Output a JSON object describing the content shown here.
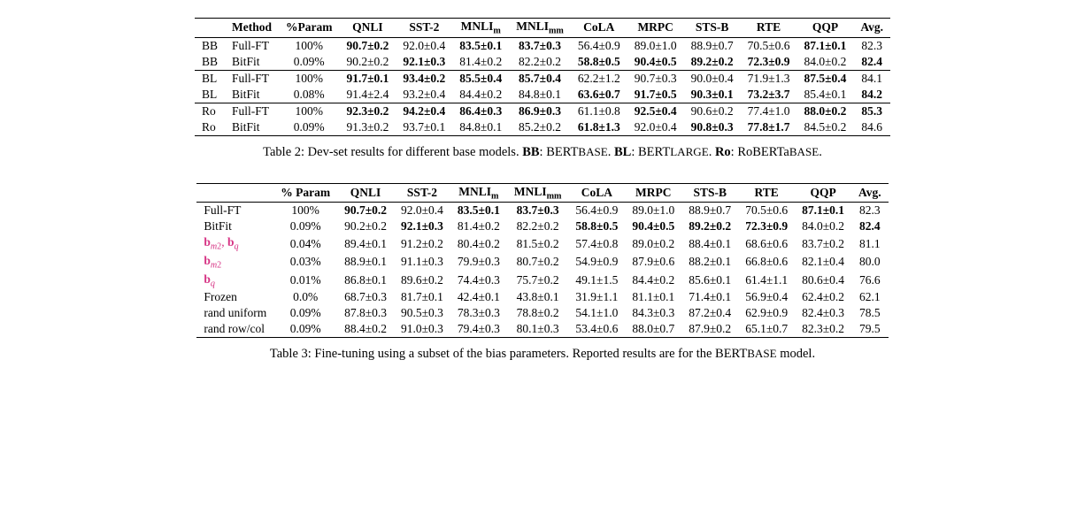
{
  "table2": {
    "headers": [
      "",
      "Method",
      "%Param",
      "QNLI",
      "SST-2",
      "MNLI_m",
      "MNLI_mm",
      "CoLA",
      "MRPC",
      "STS-B",
      "RTE",
      "QQP",
      "Avg."
    ],
    "rows": [
      {
        "model": "BB",
        "method": "Full-FT",
        "param": "100%",
        "qnli": "90.7±0.2",
        "qnli_b": true,
        "sst2": "92.0±0.4",
        "sst2_b": false,
        "mnlim": "83.5±0.1",
        "mnlim_b": true,
        "mnlimm": "83.7±0.3",
        "mnlimm_b": true,
        "cola": "56.4±0.9",
        "cola_b": false,
        "mrpc": "89.0±1.0",
        "mrpc_b": false,
        "stsb": "88.9±0.7",
        "stsb_b": false,
        "rte": "70.5±0.6",
        "rte_b": false,
        "qqp": "87.1±0.1",
        "qqp_b": true,
        "avg": "82.3",
        "avg_b": false
      },
      {
        "model": "BB",
        "method": "BitFit",
        "param": "0.09%",
        "qnli": "90.2±0.2",
        "qnli_b": false,
        "sst2": "92.1±0.3",
        "sst2_b": true,
        "mnlim": "81.4±0.2",
        "mnlim_b": false,
        "mnlimm": "82.2±0.2",
        "mnlimm_b": false,
        "cola": "58.8±0.5",
        "cola_b": true,
        "mrpc": "90.4±0.5",
        "mrpc_b": true,
        "stsb": "89.2±0.2",
        "stsb_b": true,
        "rte": "72.3±0.9",
        "rte_b": true,
        "qqp": "84.0±0.2",
        "qqp_b": false,
        "avg": "82.4",
        "avg_b": true
      },
      {
        "model": "BL",
        "method": "Full-FT",
        "param": "100%",
        "qnli": "91.7±0.1",
        "qnli_b": true,
        "sst2": "93.4±0.2",
        "sst2_b": true,
        "mnlim": "85.5±0.4",
        "mnlim_b": true,
        "mnlimm": "85.7±0.4",
        "mnlimm_b": true,
        "cola": "62.2±1.2",
        "cola_b": false,
        "mrpc": "90.7±0.3",
        "mrpc_b": false,
        "stsb": "90.0±0.4",
        "stsb_b": false,
        "rte": "71.9±1.3",
        "rte_b": false,
        "qqp": "87.5±0.4",
        "qqp_b": true,
        "avg": "84.1",
        "avg_b": false
      },
      {
        "model": "BL",
        "method": "BitFit",
        "param": "0.08%",
        "qnli": "91.4±2.4",
        "qnli_b": false,
        "sst2": "93.2±0.4",
        "sst2_b": false,
        "mnlim": "84.4±0.2",
        "mnlim_b": false,
        "mnlimm": "84.8±0.1",
        "mnlimm_b": false,
        "cola": "63.6±0.7",
        "cola_b": true,
        "mrpc": "91.7±0.5",
        "mrpc_b": true,
        "stsb": "90.3±0.1",
        "stsb_b": true,
        "rte": "73.2±3.7",
        "rte_b": true,
        "qqp": "85.4±0.1",
        "qqp_b": false,
        "avg": "84.2",
        "avg_b": true
      },
      {
        "model": "Ro",
        "method": "Full-FT",
        "param": "100%",
        "qnli": "92.3±0.2",
        "qnli_b": true,
        "sst2": "94.2±0.4",
        "sst2_b": true,
        "mnlim": "86.4±0.3",
        "mnlim_b": true,
        "mnlimm": "86.9±0.3",
        "mnlimm_b": true,
        "cola": "61.1±0.8",
        "cola_b": false,
        "mrpc": "92.5±0.4",
        "mrpc_b": true,
        "stsb": "90.6±0.2",
        "stsb_b": false,
        "rte": "77.4±1.0",
        "rte_b": false,
        "qqp": "88.0±0.2",
        "qqp_b": true,
        "avg": "85.3",
        "avg_b": true
      },
      {
        "model": "Ro",
        "method": "BitFit",
        "param": "0.09%",
        "qnli": "91.3±0.2",
        "qnli_b": false,
        "sst2": "93.7±0.1",
        "sst2_b": false,
        "mnlim": "84.8±0.1",
        "mnlim_b": false,
        "mnlimm": "85.2±0.2",
        "mnlimm_b": false,
        "cola": "61.8±1.3",
        "cola_b": true,
        "mrpc": "92.0±0.4",
        "mrpc_b": false,
        "stsb": "90.8±0.3",
        "stsb_b": true,
        "rte": "77.8±1.7",
        "rte_b": true,
        "qqp": "84.5±0.2",
        "qqp_b": false,
        "avg": "84.6",
        "avg_b": false
      }
    ],
    "caption_pre": "Table 2:  Dev-set results for different base models. ",
    "caption_bb": "BB",
    "caption_bb_ex": ": BERT",
    "caption_bb_sub": "BASE",
    "caption_bl": "BL",
    "caption_bl_ex": ": BERT",
    "caption_bl_sub": "LARGE",
    "caption_ro": "Ro",
    "caption_ro_ex": ": RoBERTa",
    "caption_ro_sub": "BASE"
  },
  "table3": {
    "headers": [
      "",
      "% Param",
      "QNLI",
      "SST-2",
      "MNLI_m",
      "MNLI_mm",
      "CoLA",
      "MRPC",
      "STS-B",
      "RTE",
      "QQP",
      "Avg."
    ],
    "rows": [
      {
        "method": "Full-FT",
        "pink": false,
        "param": "100%",
        "qnli": "90.7±0.2",
        "qnli_b": true,
        "sst2": "92.0±0.4",
        "sst2_b": false,
        "mnlim": "83.5±0.1",
        "mnlim_b": true,
        "mnlimm": "83.7±0.3",
        "mnlimm_b": true,
        "cola": "56.4±0.9",
        "cola_b": false,
        "mrpc": "89.0±1.0",
        "mrpc_b": false,
        "stsb": "88.9±0.7",
        "stsb_b": false,
        "rte": "70.5±0.6",
        "rte_b": false,
        "qqp": "87.1±0.1",
        "qqp_b": true,
        "avg": "82.3",
        "avg_b": false
      },
      {
        "method": "BitFit",
        "pink": false,
        "param": "0.09%",
        "qnli": "90.2±0.2",
        "qnli_b": false,
        "sst2": "92.1±0.3",
        "sst2_b": true,
        "mnlim": "81.4±0.2",
        "mnlim_b": false,
        "mnlimm": "82.2±0.2",
        "mnlimm_b": false,
        "cola": "58.8±0.5",
        "cola_b": true,
        "mrpc": "90.4±0.5",
        "mrpc_b": true,
        "stsb": "89.2±0.2",
        "stsb_b": true,
        "rte": "72.3±0.9",
        "rte_b": true,
        "qqp": "84.0±0.2",
        "qqp_b": false,
        "avg": "82.4",
        "avg_b": true
      },
      {
        "method": "b_m2_bq",
        "pink": true,
        "param": "0.04%",
        "qnli": "89.4±0.1",
        "qnli_b": false,
        "sst2": "91.2±0.2",
        "sst2_b": false,
        "mnlim": "80.4±0.2",
        "mnlim_b": false,
        "mnlimm": "81.5±0.2",
        "mnlimm_b": false,
        "cola": "57.4±0.8",
        "cola_b": false,
        "mrpc": "89.0±0.2",
        "mrpc_b": false,
        "stsb": "88.4±0.1",
        "stsb_b": false,
        "rte": "68.6±0.6",
        "rte_b": false,
        "qqp": "83.7±0.2",
        "qqp_b": false,
        "avg": "81.1",
        "avg_b": false
      },
      {
        "method": "b_m2",
        "pink": true,
        "param": "0.03%",
        "qnli": "88.9±0.1",
        "qnli_b": false,
        "sst2": "91.1±0.3",
        "sst2_b": false,
        "mnlim": "79.9±0.3",
        "mnlim_b": false,
        "mnlimm": "80.7±0.2",
        "mnlimm_b": false,
        "cola": "54.9±0.9",
        "cola_b": false,
        "mrpc": "87.9±0.6",
        "mrpc_b": false,
        "stsb": "88.2±0.1",
        "stsb_b": false,
        "rte": "66.8±0.6",
        "rte_b": false,
        "qqp": "82.1±0.4",
        "qqp_b": false,
        "avg": "80.0",
        "avg_b": false
      },
      {
        "method": "b_q",
        "pink": true,
        "param": "0.01%",
        "qnli": "86.8±0.1",
        "qnli_b": false,
        "sst2": "89.6±0.2",
        "sst2_b": false,
        "mnlim": "74.4±0.3",
        "mnlim_b": false,
        "mnlimm": "75.7±0.2",
        "mnlimm_b": false,
        "cola": "49.1±1.5",
        "cola_b": false,
        "mrpc": "84.4±0.2",
        "mrpc_b": false,
        "stsb": "85.6±0.1",
        "stsb_b": false,
        "rte": "61.4±1.1",
        "rte_b": false,
        "qqp": "80.6±0.4",
        "qqp_b": false,
        "avg": "76.6",
        "avg_b": false
      },
      {
        "method": "Frozen",
        "pink": false,
        "param": "0.0%",
        "qnli": "68.7±0.3",
        "qnli_b": false,
        "sst2": "81.7±0.1",
        "sst2_b": false,
        "mnlim": "42.4±0.1",
        "mnlim_b": false,
        "mnlimm": "43.8±0.1",
        "mnlimm_b": false,
        "cola": "31.9±1.1",
        "cola_b": false,
        "mrpc": "81.1±0.1",
        "mrpc_b": false,
        "stsb": "71.4±0.1",
        "stsb_b": false,
        "rte": "56.9±0.4",
        "rte_b": false,
        "qqp": "62.4±0.2",
        "qqp_b": false,
        "avg": "62.1",
        "avg_b": false
      },
      {
        "method": "rand uniform",
        "pink": false,
        "param": "0.09%",
        "qnli": "87.8±0.3",
        "qnli_b": false,
        "sst2": "90.5±0.3",
        "sst2_b": false,
        "mnlim": "78.3±0.3",
        "mnlim_b": false,
        "mnlimm": "78.8±0.2",
        "mnlimm_b": false,
        "cola": "54.1±1.0",
        "cola_b": false,
        "mrpc": "84.3±0.3",
        "mrpc_b": false,
        "stsb": "87.2±0.4",
        "stsb_b": false,
        "rte": "62.9±0.9",
        "rte_b": false,
        "qqp": "82.4±0.3",
        "qqp_b": false,
        "avg": "78.5",
        "avg_b": false
      },
      {
        "method": "rand row/col",
        "pink": false,
        "param": "0.09%",
        "qnli": "88.4±0.2",
        "qnli_b": false,
        "sst2": "91.0±0.3",
        "sst2_b": false,
        "mnlim": "79.4±0.3",
        "mnlim_b": false,
        "mnlimm": "80.1±0.3",
        "mnlimm_b": false,
        "cola": "53.4±0.6",
        "cola_b": false,
        "mrpc": "88.0±0.7",
        "mrpc_b": false,
        "stsb": "87.9±0.2",
        "stsb_b": false,
        "rte": "65.1±0.7",
        "rte_b": false,
        "qqp": "82.3±0.2",
        "qqp_b": false,
        "avg": "79.5",
        "avg_b": false
      }
    ],
    "caption_pre": "Table 3:  Fine-tuning using a subset of the bias parameters. Reported results are for the BERT",
    "caption_sub": "BASE",
    "caption_post": " model."
  }
}
